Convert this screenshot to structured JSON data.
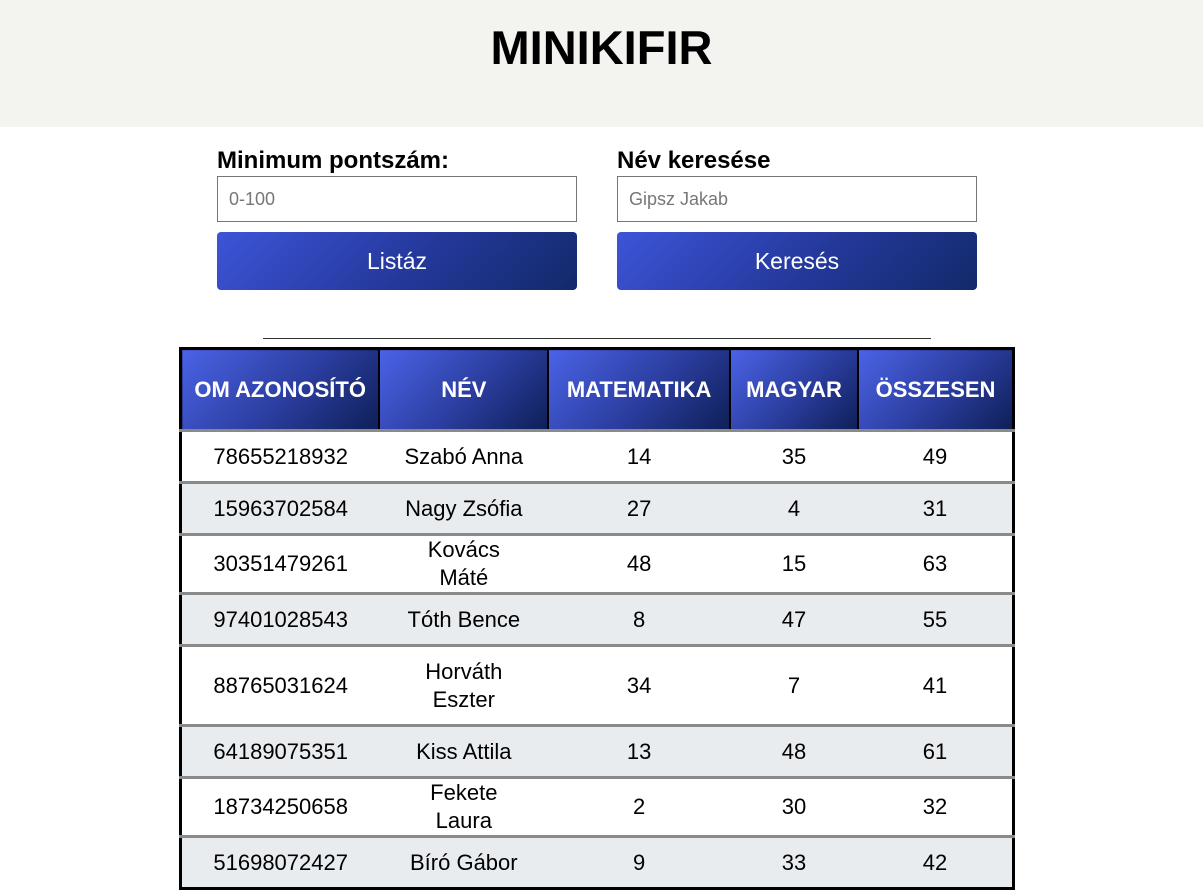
{
  "header": {
    "title": "MINIKIFIR"
  },
  "filter_min": {
    "label": "Minimum pontszám:",
    "placeholder": "0-100",
    "value": "",
    "button_label": "Listáz"
  },
  "filter_name": {
    "label": "Név keresése",
    "placeholder": "Gipsz Jakab",
    "value": "",
    "button_label": "Keresés"
  },
  "table": {
    "headers": [
      "OM AZONOSÍTÓ",
      "NÉV",
      "MATEMATIKA",
      "MAGYAR",
      "ÖSSZESEN"
    ],
    "rows": [
      {
        "om": "78655218932",
        "name": "Szabó Anna",
        "math": "14",
        "hun": "35",
        "total": "49"
      },
      {
        "om": "15963702584",
        "name": "Nagy Zsófia",
        "math": "27",
        "hun": "4",
        "total": "31"
      },
      {
        "om": "30351479261",
        "name": "Kovács Máté",
        "math": "48",
        "hun": "15",
        "total": "63"
      },
      {
        "om": "97401028543",
        "name": "Tóth Bence",
        "math": "8",
        "hun": "47",
        "total": "55"
      },
      {
        "om": "88765031624",
        "name": "Horváth Eszter",
        "math": "34",
        "hun": "7",
        "total": "41"
      },
      {
        "om": "64189075351",
        "name": "Kiss Attila",
        "math": "13",
        "hun": "48",
        "total": "61"
      },
      {
        "om": "18734250658",
        "name": "Fekete Laura",
        "math": "2",
        "hun": "30",
        "total": "32"
      },
      {
        "om": "51698072427",
        "name": "Bíró Gábor",
        "math": "9",
        "hun": "33",
        "total": "42"
      }
    ]
  },
  "colors": {
    "header_bg": "#f3f3ef",
    "button_gradient_start": "#3c55d8",
    "button_gradient_end": "#122a6a",
    "row_alt_bg": "#e9ecef"
  }
}
